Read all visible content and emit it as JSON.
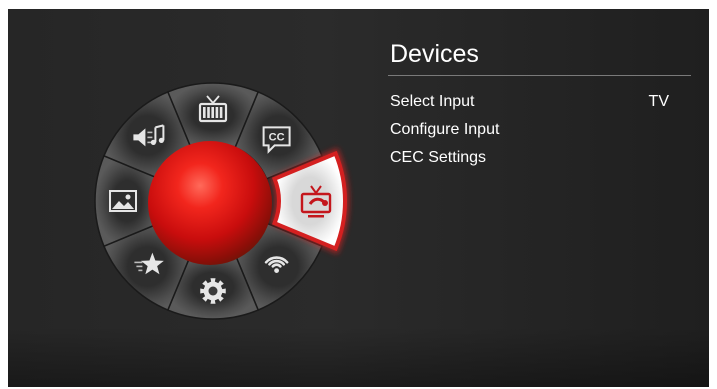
{
  "wheel": {
    "selected": "devices",
    "accent": "#d42020",
    "segments": [
      {
        "name": "tv-icon",
        "label": "tv"
      },
      {
        "name": "closed-caption-icon",
        "label": "closed captions",
        "text": "CC"
      },
      {
        "name": "devices-icon",
        "label": "devices"
      },
      {
        "name": "wifi-icon",
        "label": "network"
      },
      {
        "name": "gear-icon",
        "label": "system"
      },
      {
        "name": "star-icon",
        "label": "favorites"
      },
      {
        "name": "picture-icon",
        "label": "picture"
      },
      {
        "name": "audio-icon",
        "label": "audio"
      }
    ]
  },
  "panel": {
    "title": "Devices",
    "items": [
      {
        "label": "Select Input",
        "value": "TV"
      },
      {
        "label": "Configure Input",
        "value": ""
      },
      {
        "label": "CEC Settings",
        "value": ""
      }
    ]
  },
  "colors": {
    "background": "#282828",
    "wheel_segment": "#4a4a4a",
    "selected_segment": "#f2f2f2",
    "orb": "#e01010",
    "text": "#ffffff"
  }
}
